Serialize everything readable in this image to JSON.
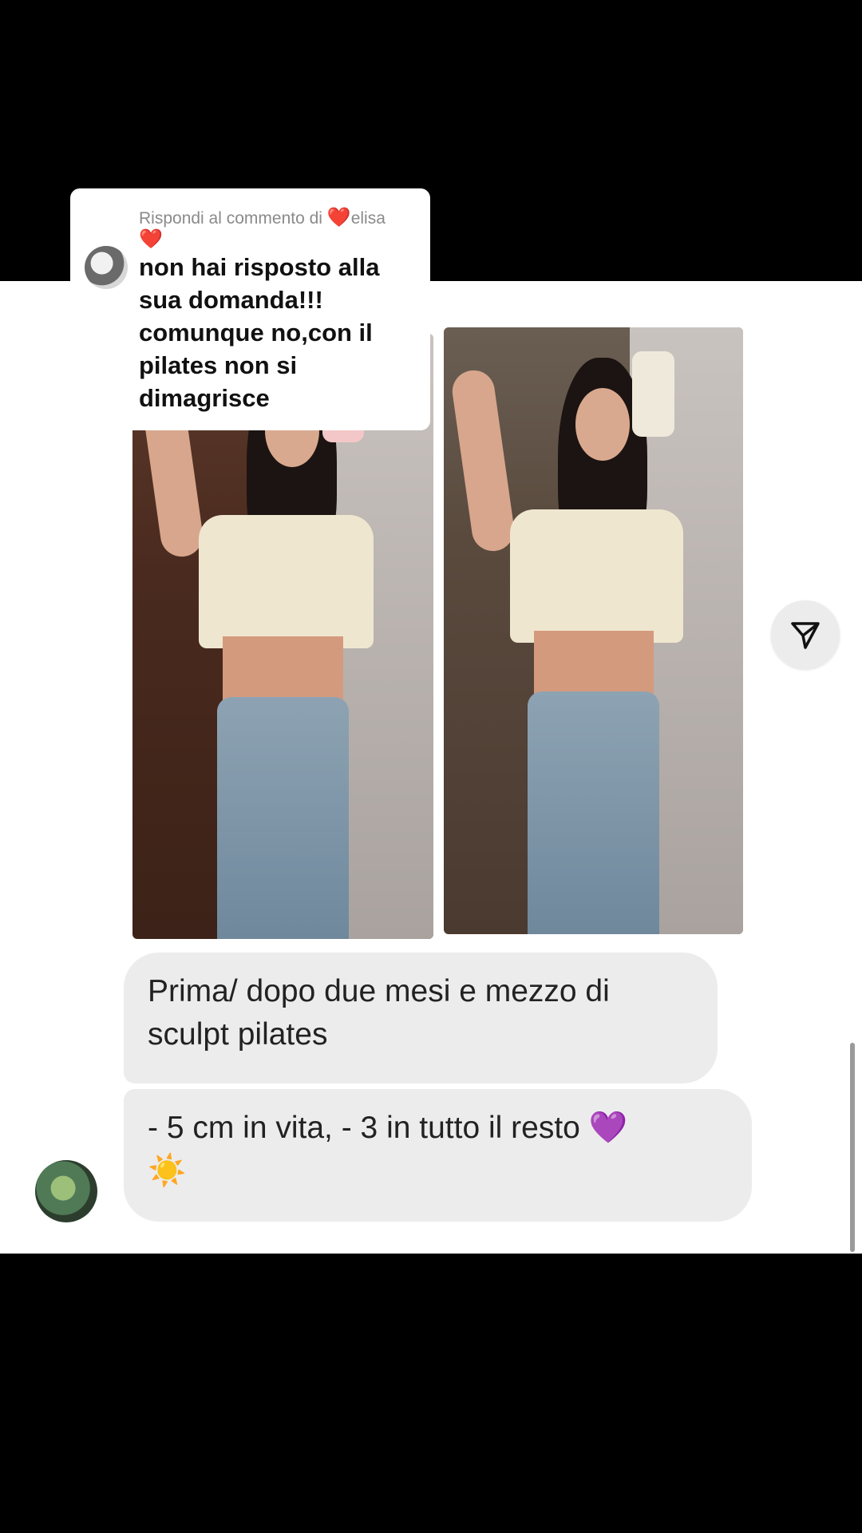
{
  "reply_card": {
    "header_prefix": "Rispondi al commento di",
    "heart_left": "❤️",
    "username": "elisa",
    "heart_right": "❤️",
    "comment": "non hai risposto alla sua domanda!!! comunque no,con il pilates non si dimagrisce"
  },
  "chat": {
    "message_1": "Prima/ dopo due mesi e mezzo di sculpt pilates",
    "message_2_text": "- 5 cm in vita, - 3 in tutto il resto",
    "message_2_emoji_heart": "💜",
    "message_2_emoji_sun": "☀️"
  },
  "icons": {
    "share": "send-icon"
  },
  "colors": {
    "background": "#000000",
    "panel": "#ffffff",
    "bubble": "#ececec",
    "heart": "#e0202a"
  }
}
